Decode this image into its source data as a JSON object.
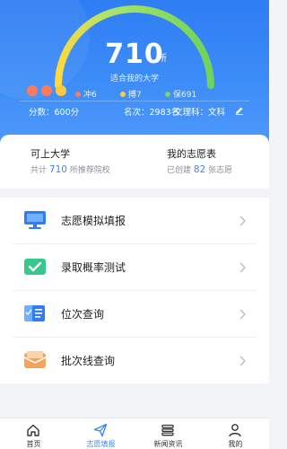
{
  "hero": {
    "score": "710",
    "score_unit": "所",
    "caption": "适合我的大学",
    "legend": [
      {
        "label": "冲6",
        "color": "#ff7a59"
      },
      {
        "label": "搏7",
        "color": "#ffc93c"
      },
      {
        "label": "保691",
        "color": "#7cd36e"
      }
    ],
    "stats": {
      "score_label": "分数：600分",
      "rank_label": "名次：2983名",
      "subject_label": "文理科：文科"
    }
  },
  "summary": {
    "left_title": "可上大学",
    "left_sub_prefix": "共计",
    "left_sub_value": "710",
    "left_sub_suffix": "所推荐院校",
    "right_title": "我的志愿表",
    "right_sub_prefix": "已创建",
    "right_sub_value": "82",
    "right_sub_suffix": "张志愿"
  },
  "menu": {
    "items": [
      {
        "label": "志愿模拟填报",
        "icon": "monitor-icon"
      },
      {
        "label": "录取概率测试",
        "icon": "check-card-icon"
      },
      {
        "label": "位次查询",
        "icon": "rank-doc-icon"
      },
      {
        "label": "批次线查询",
        "icon": "envelope-icon"
      }
    ]
  },
  "tabbar": {
    "tabs": [
      {
        "label": "首页",
        "icon": "home-icon"
      },
      {
        "label": "志愿填报",
        "icon": "send-icon",
        "active": true
      },
      {
        "label": "新闻资讯",
        "icon": "news-icon"
      },
      {
        "label": "我的",
        "icon": "user-icon"
      }
    ]
  },
  "colors": {
    "primary": "#3f86f5",
    "hero_bg": "#3c8cf7",
    "gauge_green": "#7ed957",
    "gauge_yellow": "#ffd93d",
    "dot_orange": "#ff7a59",
    "dot_yellow": "#ffc93c",
    "dot_green": "#7cd36e"
  }
}
